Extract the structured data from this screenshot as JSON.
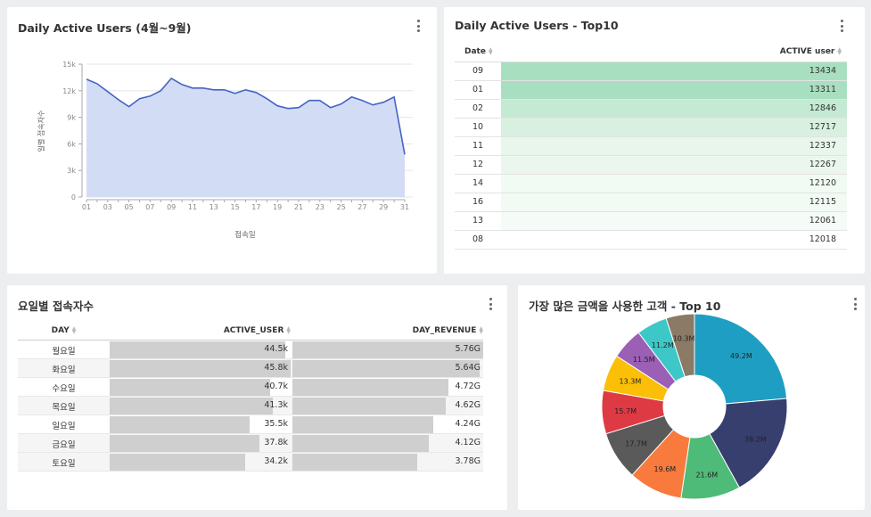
{
  "panels": {
    "line": {
      "title": "Daily Active Users (4월~9월)"
    },
    "top10": {
      "title": "Daily Active Users - Top10",
      "col_date": "Date",
      "col_active": "ACTIVE user"
    },
    "weekday": {
      "title": "요일별 접속자수",
      "col_day": "DAY",
      "col_active": "ACTIVE_USER",
      "col_revenue": "DAY_REVENUE"
    },
    "pie": {
      "title": "가장 많은 금액을 사용한 고객 - Top 10"
    }
  },
  "chart_data": [
    {
      "type": "area",
      "title": "Daily Active Users (4월~9월)",
      "xlabel": "접속일",
      "ylabel": "일별 접속자수",
      "x": [
        "01",
        "02",
        "03",
        "04",
        "05",
        "06",
        "07",
        "08",
        "09",
        "10",
        "11",
        "12",
        "13",
        "14",
        "15",
        "16",
        "17",
        "18",
        "19",
        "20",
        "21",
        "22",
        "23",
        "24",
        "25",
        "26",
        "27",
        "28",
        "29",
        "30",
        "31"
      ],
      "x_ticks": [
        "01",
        "03",
        "05",
        "07",
        "09",
        "11",
        "13",
        "15",
        "17",
        "19",
        "21",
        "23",
        "25",
        "27",
        "29",
        "31"
      ],
      "values": [
        13300,
        12800,
        11900,
        11000,
        10200,
        11100,
        11400,
        12000,
        13400,
        12700,
        12300,
        12300,
        12100,
        12100,
        11700,
        12100,
        11800,
        11100,
        10300,
        10000,
        10100,
        10900,
        10900,
        10100,
        10500,
        11300,
        10900,
        10400,
        10700,
        11300,
        4800
      ],
      "ylim": [
        0,
        15000
      ],
      "y_ticks": [
        "0",
        "3k",
        "6k",
        "9k",
        "12k",
        "15k"
      ],
      "grid": true,
      "color": "#4565c4",
      "fill": "#d3dcf5"
    },
    {
      "type": "table",
      "title": "Daily Active Users - Top10",
      "rows": [
        {
          "date": "09",
          "value": 13434,
          "color": "#a9dfc1"
        },
        {
          "date": "01",
          "value": 13311,
          "color": "#a9dfc1"
        },
        {
          "date": "02",
          "value": 12846,
          "color": "#c4ead3"
        },
        {
          "date": "10",
          "value": 12717,
          "color": "#d7f0e0"
        },
        {
          "date": "11",
          "value": 12337,
          "color": "#e8f6ec"
        },
        {
          "date": "12",
          "value": 12267,
          "color": "#ebf7ee"
        },
        {
          "date": "14",
          "value": 12120,
          "color": "#f2faf4"
        },
        {
          "date": "16",
          "value": 12115,
          "color": "#f2faf4"
        },
        {
          "date": "13",
          "value": 12061,
          "color": "#f5fbf6"
        },
        {
          "date": "08",
          "value": 12018,
          "color": "#ffffff"
        }
      ]
    },
    {
      "type": "table",
      "title": "요일별 접속자수",
      "rows": [
        {
          "day": "월요일",
          "active": 44500,
          "active_label": "44.5k",
          "revenue": 5.76,
          "revenue_label": "5.76G"
        },
        {
          "day": "화요일",
          "active": 45800,
          "active_label": "45.8k",
          "revenue": 5.64,
          "revenue_label": "5.64G"
        },
        {
          "day": "수요일",
          "active": 40700,
          "active_label": "40.7k",
          "revenue": 4.72,
          "revenue_label": "4.72G"
        },
        {
          "day": "목요일",
          "active": 41300,
          "active_label": "41.3k",
          "revenue": 4.62,
          "revenue_label": "4.62G"
        },
        {
          "day": "일요일",
          "active": 35500,
          "active_label": "35.5k",
          "revenue": 4.24,
          "revenue_label": "4.24G"
        },
        {
          "day": "금요일",
          "active": 37800,
          "active_label": "37.8k",
          "revenue": 4.12,
          "revenue_label": "4.12G"
        },
        {
          "day": "토요일",
          "active": 34200,
          "active_label": "34.2k",
          "revenue": 3.78,
          "revenue_label": "3.78G"
        }
      ]
    },
    {
      "type": "pie",
      "title": "가장 많은 금액을 사용한 고객 - Top 10",
      "donut": true,
      "slices": [
        {
          "label": "49.2M",
          "value": 49.2,
          "color": "#1f9ec3"
        },
        {
          "label": "38.2M",
          "value": 38.2,
          "color": "#373f6e"
        },
        {
          "label": "21.6M",
          "value": 21.6,
          "color": "#4fbb78"
        },
        {
          "label": "19.6M",
          "value": 19.6,
          "color": "#f97a3d"
        },
        {
          "label": "17.7M",
          "value": 17.7,
          "color": "#5a5a5a"
        },
        {
          "label": "15.7M",
          "value": 15.7,
          "color": "#de3a44"
        },
        {
          "label": "13.3M",
          "value": 13.3,
          "color": "#fbbf08"
        },
        {
          "label": "11.5M",
          "value": 11.5,
          "color": "#9b5fb5"
        },
        {
          "label": "11.2M",
          "value": 11.2,
          "color": "#3ec7c7"
        },
        {
          "label": "10.3M",
          "value": 10.3,
          "color": "#8a7a66"
        }
      ]
    }
  ]
}
